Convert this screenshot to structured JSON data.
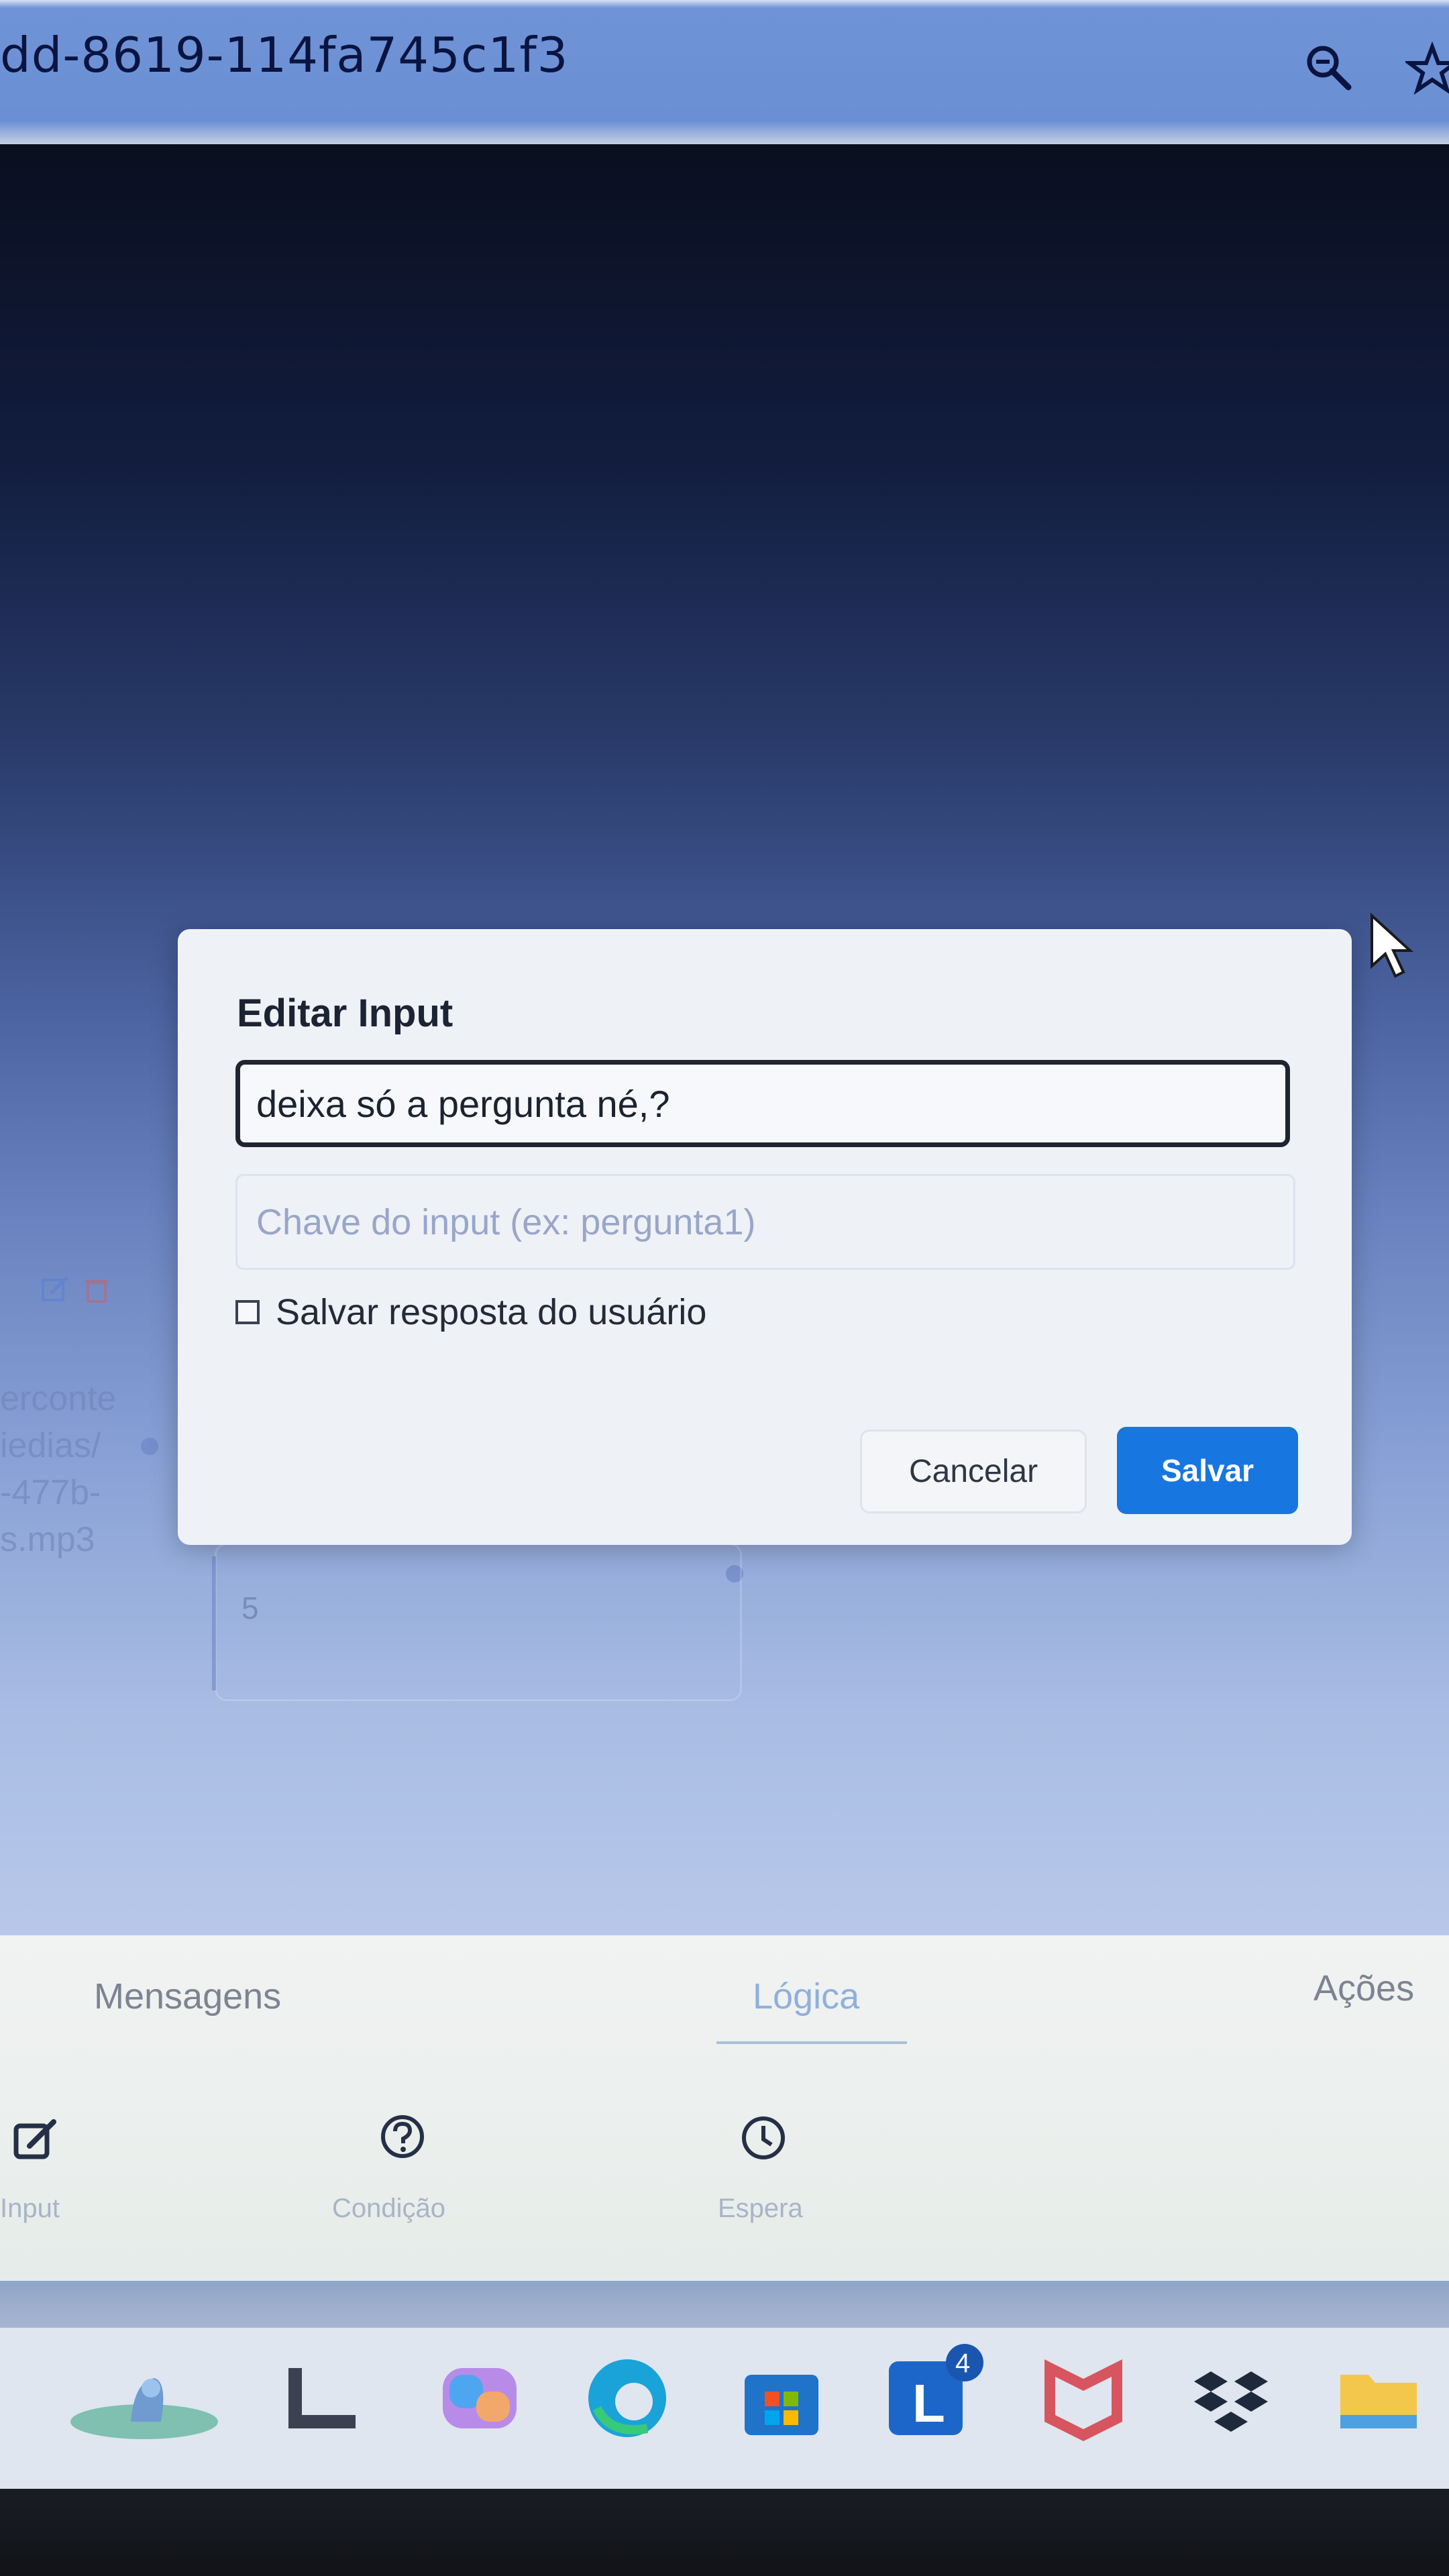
{
  "browser": {
    "url_fragment": "dd-8619-114fa745c1f3",
    "icons": [
      "zoom-icon",
      "star-icon"
    ]
  },
  "background": {
    "node_text_lines": [
      "erconte",
      "iedias/",
      "-477b-",
      "s.mp3"
    ],
    "node_number": "5",
    "icons": [
      "edit-icon",
      "trash-icon"
    ]
  },
  "modal": {
    "title": "Editar Input",
    "question_value": "deixa só a pergunta né,?",
    "key_placeholder": "Chave do input (ex: pergunta1)",
    "checkbox_label": "Salvar resposta do usuário",
    "checkbox_checked": false,
    "cancel_label": "Cancelar",
    "save_label": "Salvar",
    "colors": {
      "save_button": "#1876e0",
      "input_border": "#1e2431"
    }
  },
  "bottom_panel": {
    "tabs": [
      {
        "label": "Mensagens",
        "active": false
      },
      {
        "label": "Lógica",
        "active": true
      },
      {
        "label": "Ações",
        "active": false
      }
    ],
    "tools": [
      {
        "label": "Input",
        "icon": "edit-icon"
      },
      {
        "label": "Condição",
        "icon": "question-icon"
      },
      {
        "label": "Espera",
        "icon": "clock-icon"
      }
    ]
  },
  "taskbar": {
    "items": [
      {
        "name": "widgets-icon"
      },
      {
        "name": "explorer-l-icon"
      },
      {
        "name": "copilot-icon"
      },
      {
        "name": "edge-icon"
      },
      {
        "name": "store-icon"
      },
      {
        "name": "app-l-icon",
        "badge": "4"
      },
      {
        "name": "mcafee-icon"
      },
      {
        "name": "dropbox-icon"
      },
      {
        "name": "folder-icon"
      }
    ]
  }
}
